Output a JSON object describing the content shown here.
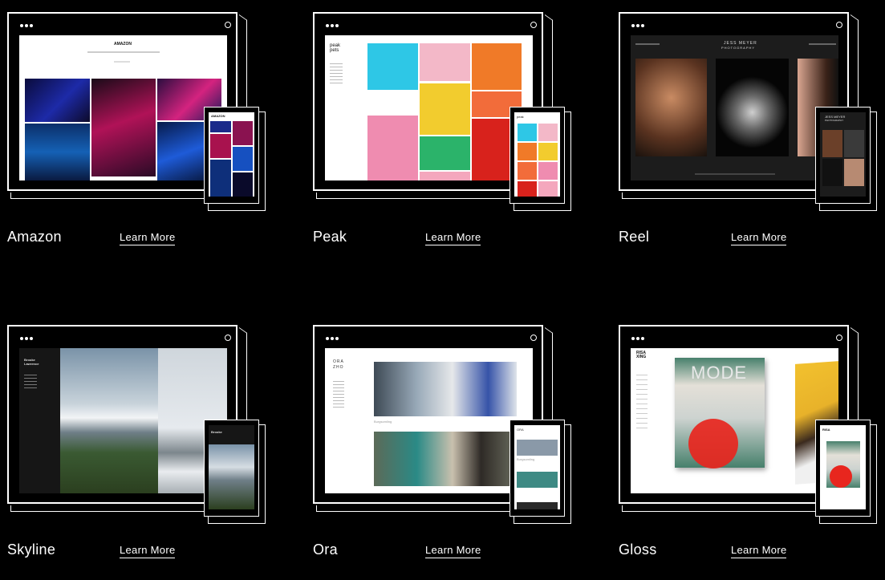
{
  "templates": [
    {
      "name": "Amazon",
      "learn": "Learn More",
      "site_title": "AMAZON",
      "screen_text": ""
    },
    {
      "name": "Peak",
      "learn": "Learn More",
      "site_title": "peak pets",
      "screen_text": ""
    },
    {
      "name": "Reel",
      "learn": "Learn More",
      "site_title": "JESS MEYER",
      "screen_text": "PHOTOGRAPHY"
    },
    {
      "name": "Skyline",
      "learn": "Learn More",
      "site_title": "Brooke Lawrence",
      "screen_text": ""
    },
    {
      "name": "Ora",
      "learn": "Learn More",
      "site_title": "ORA ZHO",
      "screen_text": "Burgsomling"
    },
    {
      "name": "Gloss",
      "learn": "Learn More",
      "site_title": "RISA XING",
      "screen_text": "MODE"
    }
  ],
  "icons": {
    "window_dots": "three-dots-icon",
    "power": "power-icon"
  }
}
